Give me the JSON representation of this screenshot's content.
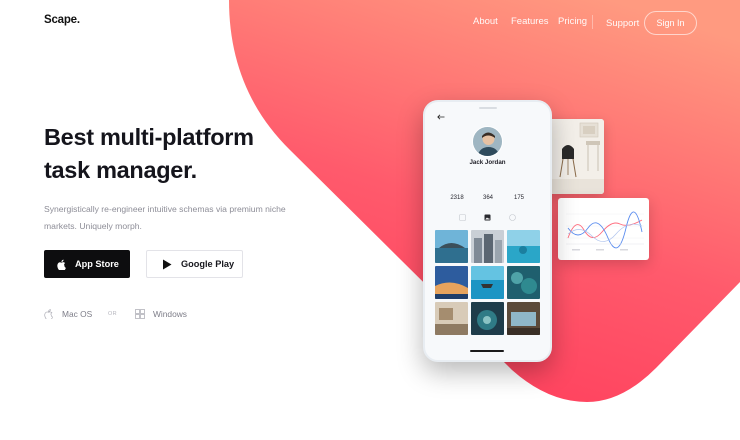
{
  "nav": {
    "logo": "Scape.",
    "links": [
      "About",
      "Features",
      "Pricing",
      "Support"
    ],
    "signin": "Sign In"
  },
  "hero": {
    "title_lines": [
      "Best multi-platform",
      "task manager."
    ],
    "subtitle_lines": [
      "Synergistically re-engineer intuitive schemas via premium niche",
      "markets. Uniquely morph."
    ],
    "app_store": "App Store",
    "google_play": "Google Play",
    "mac": "Mac OS",
    "or": "OR",
    "windows": "Windows"
  },
  "phone": {
    "name": "Jack Jordan",
    "stats": [
      {
        "value": "2318"
      },
      {
        "value": "364"
      },
      {
        "value": "175"
      }
    ]
  },
  "colors": {
    "accent_top": "#ff8a7a",
    "accent_bottom": "#ff3c5f",
    "dark_button": "#0d0d0f"
  },
  "icons": [
    "apple-icon",
    "play-icon",
    "windows-icon",
    "back-arrow-icon",
    "grid-icon",
    "image-icon",
    "settings-icon"
  ]
}
